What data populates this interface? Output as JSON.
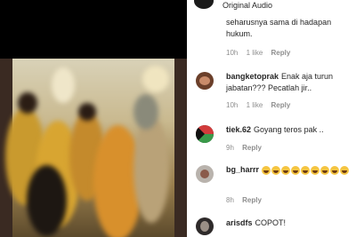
{
  "audio": {
    "label": "Original Audio",
    "icon": "music-disc-icon"
  },
  "comments": [
    {
      "text": "seharusnya sama di hadapan hukum.",
      "time": "10h",
      "likes": "1 like",
      "reply": "Reply"
    },
    {
      "username": "bangketoprak",
      "text": "Enak aja turun jabatan??? Pecatlah jir..",
      "time": "10h",
      "likes": "1 like",
      "reply": "Reply"
    },
    {
      "username": "tiek.62",
      "text": "Goyang teros pak ..",
      "time": "9h",
      "reply": "Reply"
    },
    {
      "username": "bg_harrr",
      "emoji_count": 9,
      "time": "8h",
      "reply": "Reply"
    },
    {
      "username": "arisdfs",
      "text": "COPOT!"
    }
  ],
  "colors": {
    "meta": "#8e8e8e",
    "text": "#262626",
    "emoji": "#f5c542"
  }
}
